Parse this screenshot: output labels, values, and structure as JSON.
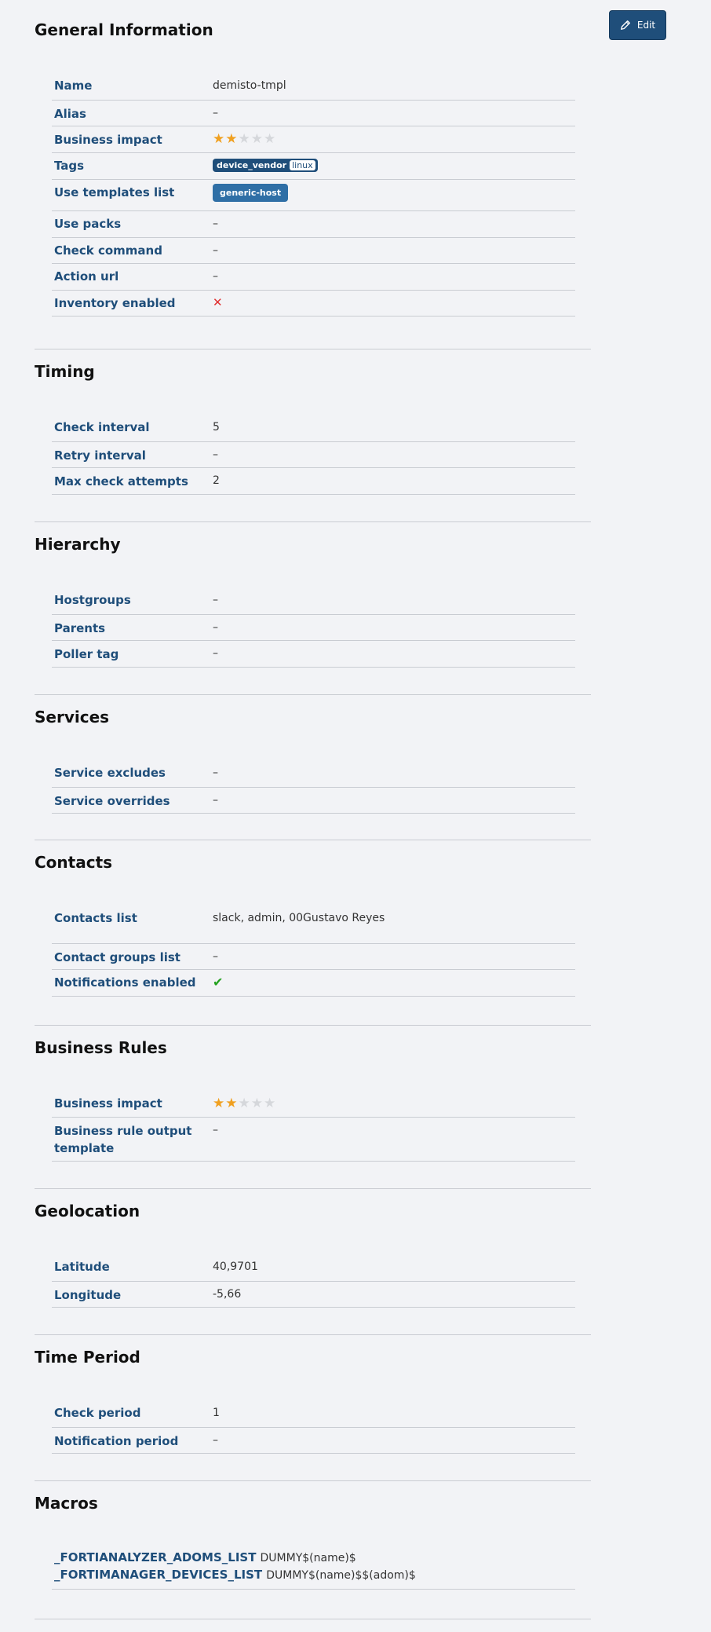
{
  "toolbar": {
    "edit_label": "Edit"
  },
  "general": {
    "title": "General Information",
    "rows": [
      {
        "key": "Name",
        "value": "demisto-tmpl"
      },
      {
        "key": "Alias",
        "value": "–"
      },
      {
        "key": "Business impact",
        "stars": 2,
        "max_stars": 5
      },
      {
        "key": "Tags",
        "tag_name": "device_vendor",
        "tag_value": "linux"
      },
      {
        "key": "Use templates list",
        "pill": "generic-host"
      },
      {
        "key": "Use packs",
        "value": "–"
      },
      {
        "key": "Check command",
        "value": "–"
      },
      {
        "key": "Action url",
        "value": "–"
      },
      {
        "key": "Inventory enabled",
        "icon": "x-icon"
      }
    ]
  },
  "timing": {
    "title": "Timing",
    "rows": [
      {
        "key": "Check interval",
        "value": "5"
      },
      {
        "key": "Retry interval",
        "value": "–"
      },
      {
        "key": "Max check attempts",
        "value": "2"
      }
    ]
  },
  "hierarchy": {
    "title": "Hierarchy",
    "rows": [
      {
        "key": "Hostgroups",
        "value": "–"
      },
      {
        "key": "Parents",
        "value": "–"
      },
      {
        "key": "Poller tag",
        "value": "–"
      }
    ]
  },
  "services": {
    "title": "Services",
    "rows": [
      {
        "key": "Service excludes",
        "value": "–"
      },
      {
        "key": "Service overrides",
        "value": "–"
      }
    ]
  },
  "contacts": {
    "title": "Contacts",
    "rows": [
      {
        "key": "Contacts list",
        "value": "slack, admin, 00Gustavo Reyes"
      },
      {
        "key": "Contact groups list",
        "value": "–"
      },
      {
        "key": "Notifications enabled",
        "icon": "check-icon"
      }
    ]
  },
  "business_rules": {
    "title": "Business Rules",
    "rows": [
      {
        "key": "Business impact",
        "stars": 2,
        "max_stars": 5
      },
      {
        "key": "Business rule output template",
        "value": "–"
      }
    ]
  },
  "geolocation": {
    "title": "Geolocation",
    "rows": [
      {
        "key": "Latitude",
        "value": "40,9701"
      },
      {
        "key": "Longitude",
        "value": "-5,66"
      }
    ]
  },
  "time_period": {
    "title": "Time Period",
    "rows": [
      {
        "key": "Check period",
        "value": "1"
      },
      {
        "key": "Notification period",
        "value": "–"
      }
    ]
  },
  "macros": {
    "title": "Macros",
    "items": [
      {
        "key": "_FORTIANALYZER_ADOMS_LIST",
        "value": "DUMMY$(name)$"
      },
      {
        "key": "_FORTIMANAGER_DEVICES_LIST",
        "value": "DUMMY$(name)$$(adom)$"
      }
    ]
  },
  "colors": {
    "accent": "#1f4e7a",
    "star": "#f0a020",
    "no": "#e03030",
    "yes": "#22a11e"
  }
}
